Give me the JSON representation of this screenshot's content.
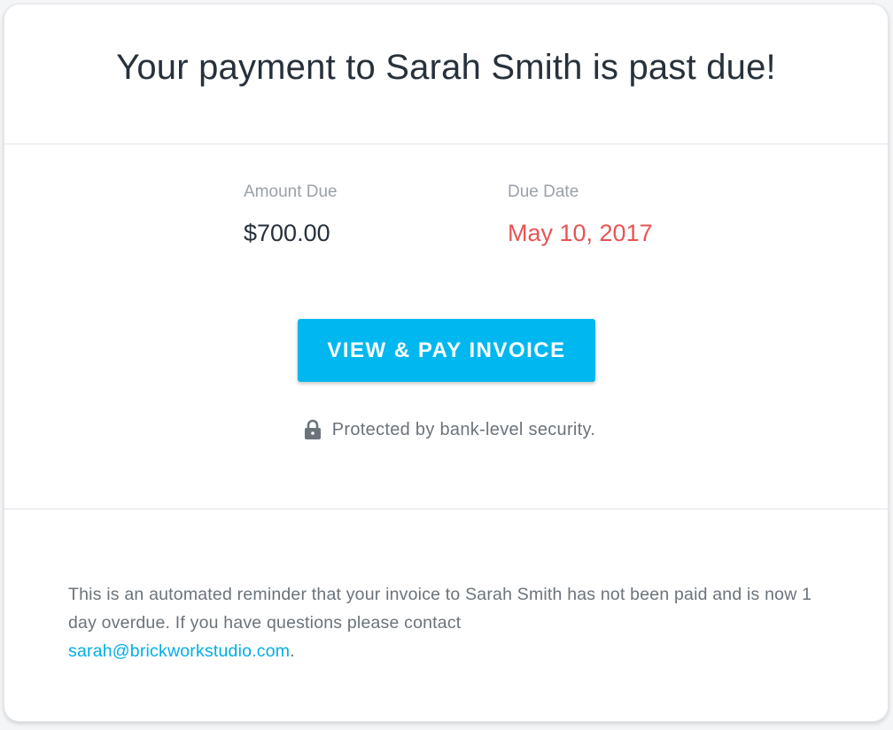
{
  "header": {
    "title": "Your payment to Sarah Smith is past due!"
  },
  "details": {
    "amount_label": "Amount Due",
    "amount_value": "$700.00",
    "due_label": "Due Date",
    "due_value": "May 10, 2017"
  },
  "action": {
    "button_label": "VIEW & PAY INVOICE"
  },
  "security": {
    "icon": "lock-icon",
    "text": "Protected by bank-level security."
  },
  "footer": {
    "message": "This is an automated reminder that your invoice to Sarah Smith has not been paid and is now 1 day overdue. If you have questions please contact",
    "contact_email": "sarah@brickworkstudio.com",
    "trailing": "."
  },
  "colors": {
    "accent": "#00b8ef",
    "overdue": "#e85454",
    "link": "#00aee6"
  }
}
